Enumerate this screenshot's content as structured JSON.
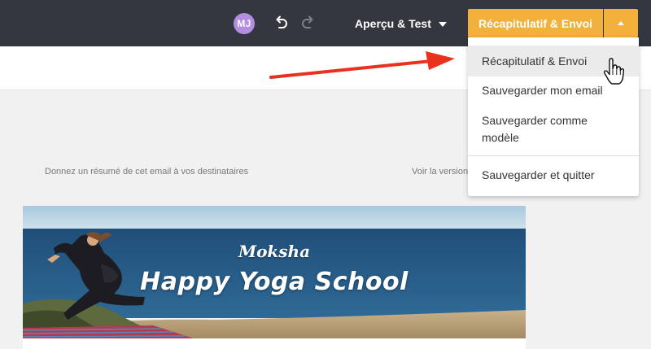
{
  "topbar": {
    "avatar_initials": "MJ",
    "undo_icon": "undo-icon",
    "redo_icon": "redo-icon",
    "preview_label": "Aperçu & Test",
    "send_label": "Récapitulatif & Envoi"
  },
  "dropdown": {
    "items": [
      {
        "label": "Récapitulatif & Envoi"
      },
      {
        "label": "Sauvegarder mon email"
      },
      {
        "label": "Sauvegarder comme modèle"
      },
      {
        "label": "Sauvegarder et quitter"
      }
    ]
  },
  "email": {
    "preheader": "Donnez un résumé de cet email à vos destinataires",
    "view_online": "Voir la version",
    "banner_subtitle": "Moksha",
    "banner_title": "Happy Yoga School"
  },
  "colors": {
    "topbar": "#34373f",
    "accent": "#f2b13a",
    "avatar": "#b28de0",
    "annotation_arrow": "#e8321e"
  }
}
